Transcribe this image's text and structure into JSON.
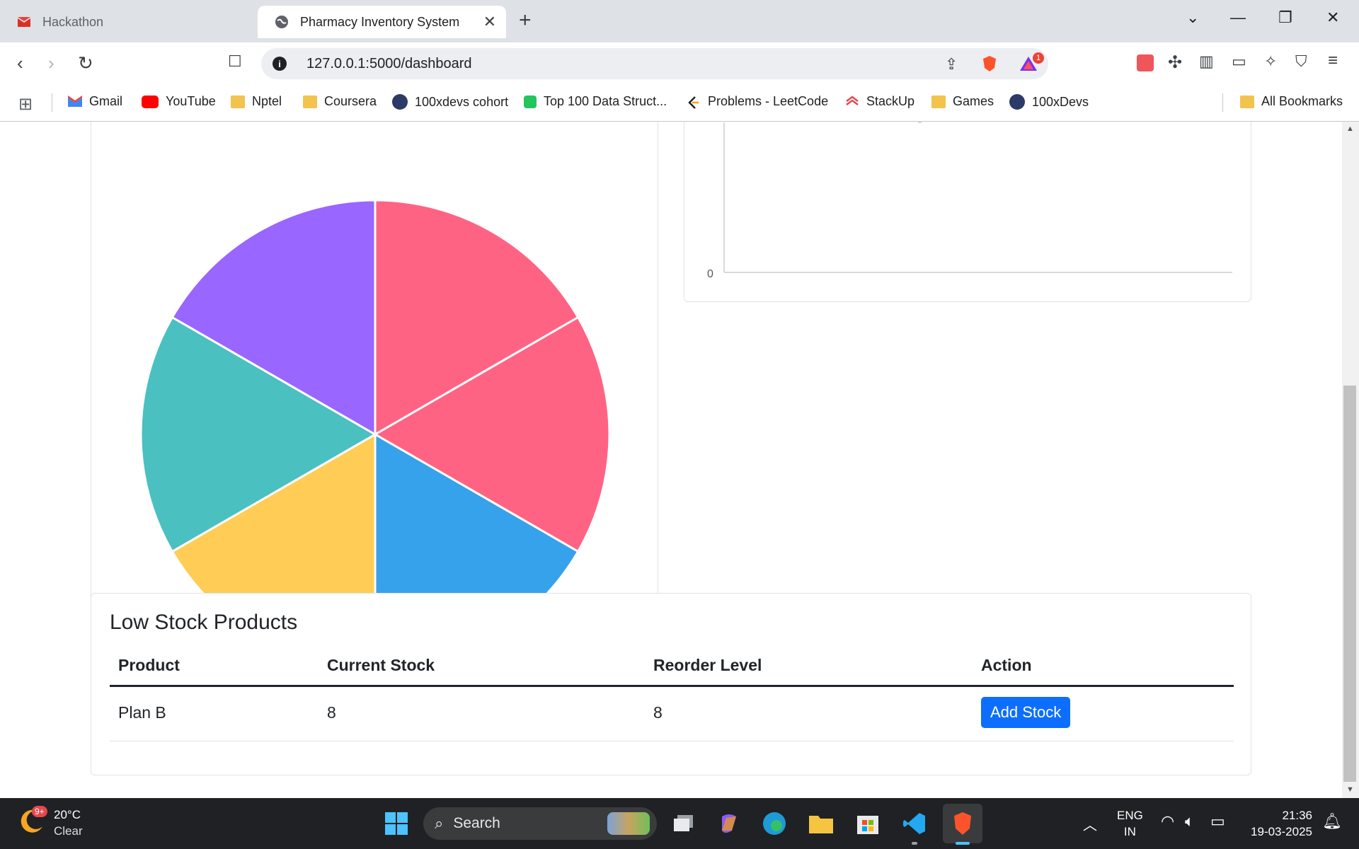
{
  "browser": {
    "tabs": [
      {
        "label": "Hackathon",
        "active": false
      },
      {
        "label": "Pharmacy Inventory System",
        "active": true
      }
    ],
    "new_tab": "+",
    "url": "127.0.0.1:5000/dashboard",
    "notification_count": "1",
    "bookmarks": [
      {
        "label": "Gmail",
        "icon": "gmail-icon"
      },
      {
        "label": "YouTube",
        "icon": "youtube-icon"
      },
      {
        "label": "Nptel",
        "icon": "folder-icon"
      },
      {
        "label": "Coursera",
        "icon": "folder-icon"
      },
      {
        "label": "100xdevs cohort",
        "icon": "avatar-icon"
      },
      {
        "label": "Top 100 Data Struct...",
        "icon": "green-badge-icon"
      },
      {
        "label": "Problems - LeetCode",
        "icon": "leetcode-icon"
      },
      {
        "label": "StackUp",
        "icon": "stackup-icon"
      },
      {
        "label": "Games",
        "icon": "folder-icon"
      },
      {
        "label": "100xDevs",
        "icon": "avatar-icon"
      },
      {
        "label": "All Bookmarks",
        "icon": "folder-icon"
      }
    ]
  },
  "dashboard": {
    "pie_colors": [
      "#ff6384",
      "#ff6384",
      "#36a2eb",
      "#ffcd56",
      "#4bc0c0",
      "#9966ff"
    ],
    "bar_axis_zero": "0",
    "low_stock": {
      "title": "Low Stock Products",
      "columns": [
        "Product",
        "Current Stock",
        "Reorder Level",
        "Action"
      ],
      "rows": [
        {
          "product": "Plan B",
          "current_stock": "8",
          "reorder_level": "8",
          "action": "Add Stock"
        }
      ]
    }
  },
  "chart_data": {
    "type": "pie",
    "values": [
      1,
      1,
      1,
      1,
      1,
      1
    ],
    "colors": [
      "#ff6384",
      "#ff6384",
      "#36a2eb",
      "#ffcd56",
      "#4bc0c0",
      "#9966ff"
    ]
  },
  "taskbar": {
    "weather_temp": "20°C",
    "weather_desc": "Clear",
    "weather_badge": "9+",
    "search_label": "Search",
    "lang": "ENG",
    "region": "IN",
    "time": "21:36",
    "date": "19-03-2025"
  }
}
